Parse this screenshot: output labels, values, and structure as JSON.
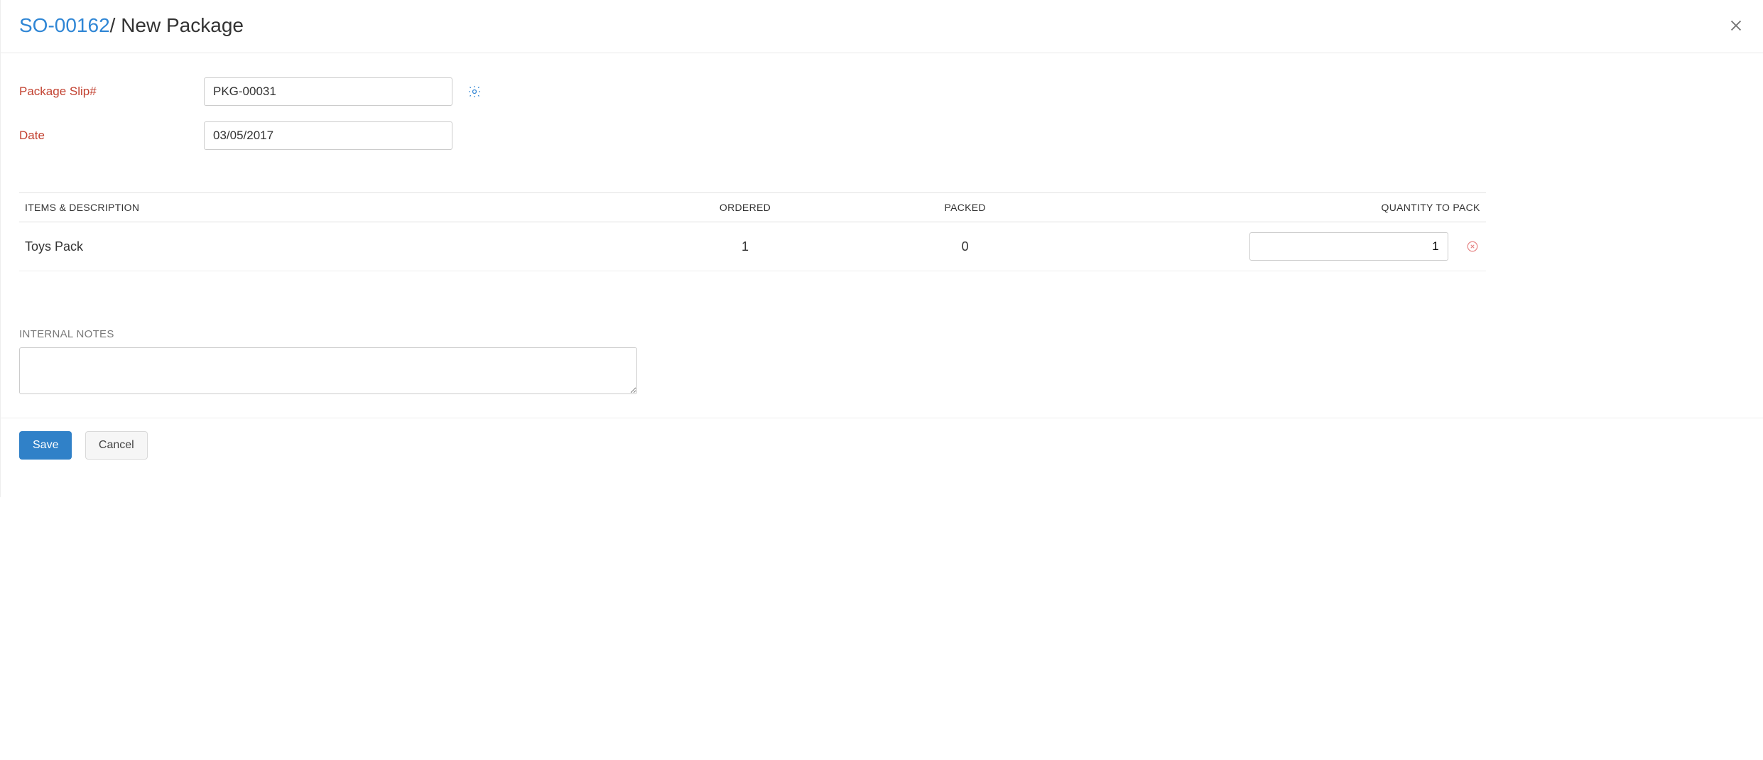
{
  "header": {
    "so_number": "SO-00162",
    "title_suffix": " New Package"
  },
  "form": {
    "package_slip_label": "Package Slip#",
    "package_slip_value": "PKG-00031",
    "date_label": "Date",
    "date_value": "03/05/2017"
  },
  "table": {
    "headers": {
      "items": "ITEMS & DESCRIPTION",
      "ordered": "ORDERED",
      "packed": "PACKED",
      "qty_to_pack": "QUANTITY TO PACK"
    },
    "rows": [
      {
        "name": "Toys Pack",
        "ordered": "1",
        "packed": "0",
        "qty_to_pack": "1"
      }
    ]
  },
  "notes": {
    "label": "INTERNAL NOTES",
    "value": ""
  },
  "buttons": {
    "save": "Save",
    "cancel": "Cancel"
  }
}
